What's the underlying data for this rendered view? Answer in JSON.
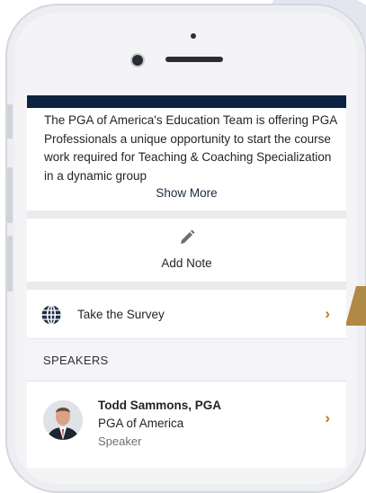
{
  "event": {
    "description": "The PGA of America's Education Team is offering PGA Professionals a unique opportunity to start the course work required for Teaching & Coaching Specialization in a dynamic group",
    "show_more_label": "Show More"
  },
  "actions": {
    "add_note_label": "Add Note",
    "survey_label": "Take the Survey"
  },
  "speakers": {
    "header": "SPEAKERS",
    "items": [
      {
        "name": "Todd Sammons, PGA",
        "organization": "PGA of America",
        "role": "Speaker"
      }
    ]
  },
  "colors": {
    "navbar": "#0d2240",
    "accent_chevron": "#c07a12",
    "show_more_text": "#1e2a44"
  },
  "icons": {
    "note": "pencil-icon",
    "survey": "globe-icon",
    "row_arrow": "chevron-right-icon"
  }
}
